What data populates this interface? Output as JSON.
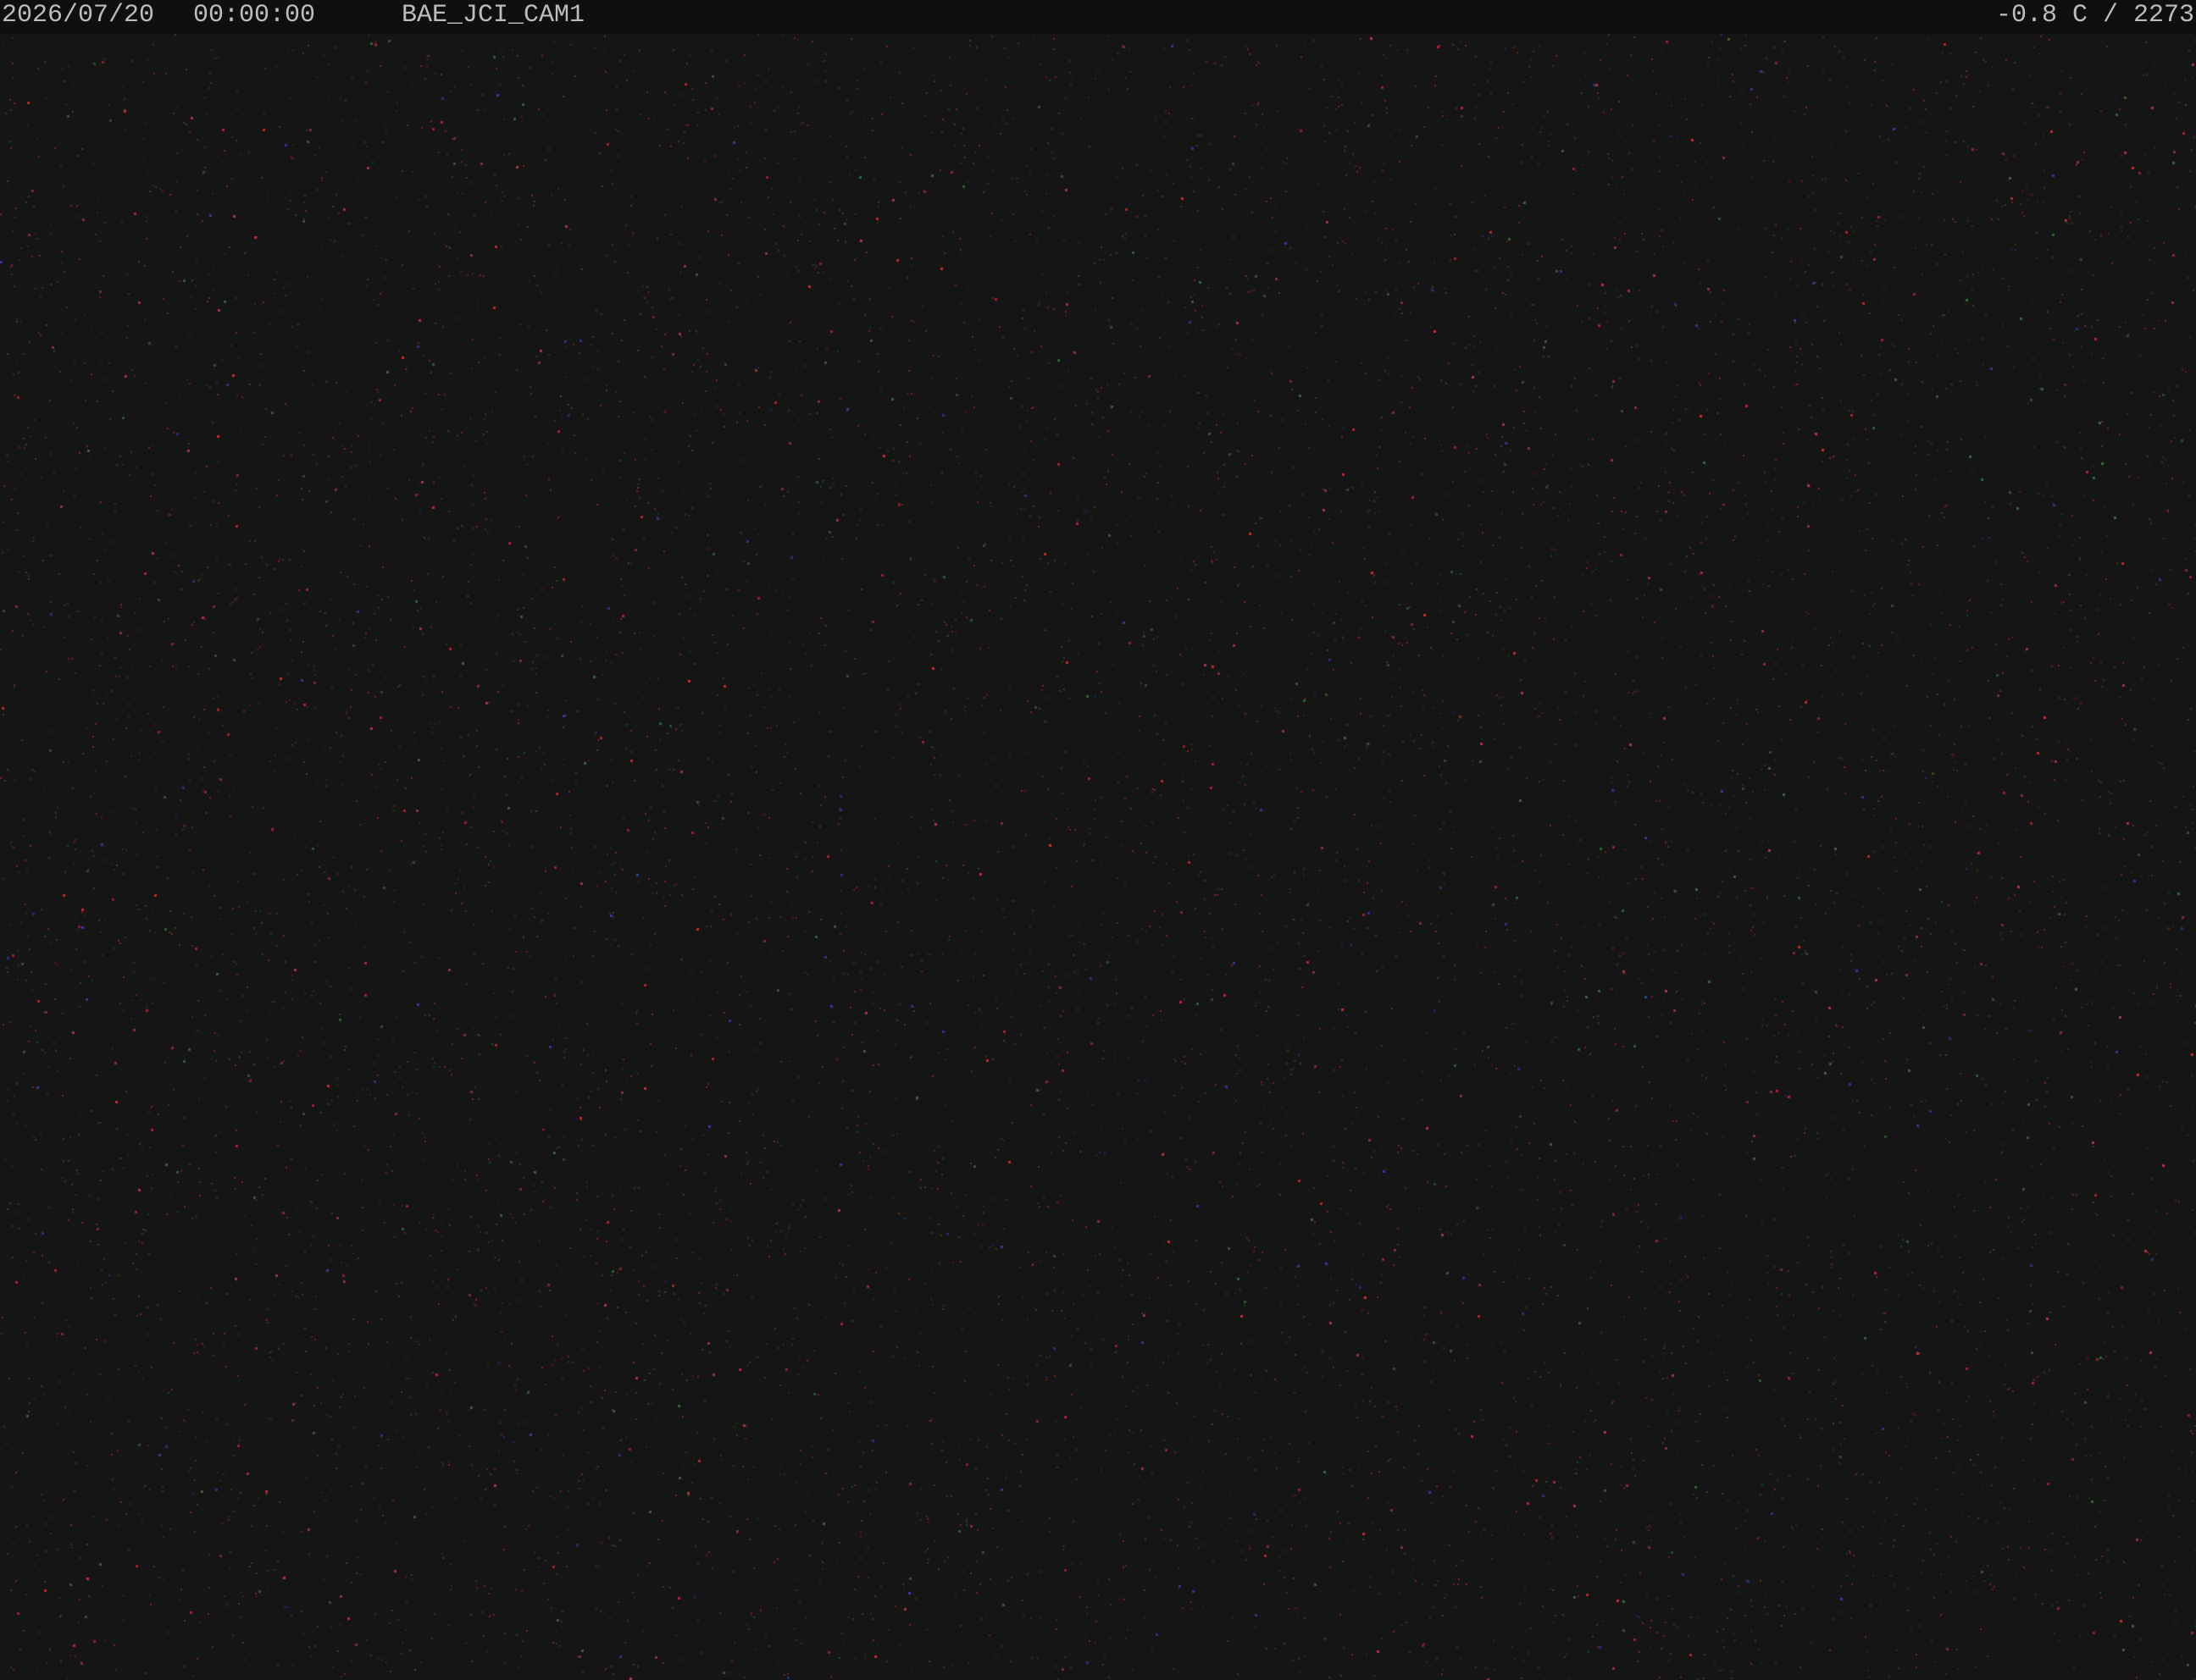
{
  "overlay": {
    "date": "2026/07/20",
    "time": "00:00:00",
    "camera_name": "BAE_JCI_CAM1",
    "temperature_reading": "-0.8 C / 2273"
  },
  "colors": {
    "background": "#151515",
    "overlay_text": "#bdbdbd",
    "noise_red": "#c0303a",
    "noise_green": "#3a6a3a",
    "noise_blue": "#3a3aa0"
  }
}
